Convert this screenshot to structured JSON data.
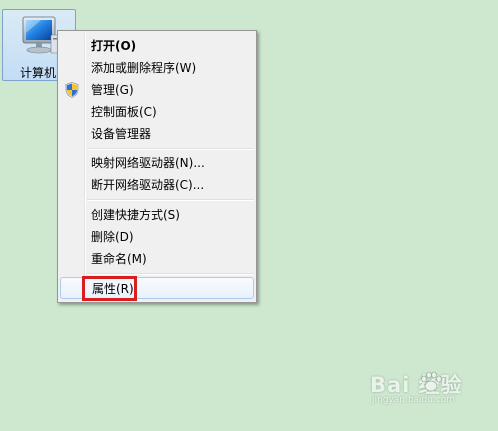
{
  "desktop": {
    "background_color": "#cde8cf",
    "icon": {
      "label": "计算机",
      "icon_name": "computer-icon"
    }
  },
  "context_menu": {
    "items": [
      {
        "label": "打开(O)",
        "bold": true
      },
      {
        "label": "添加或删除程序(W)"
      },
      {
        "label": "管理(G)",
        "icon_name": "uac-shield-icon"
      },
      {
        "label": "控制面板(C)"
      },
      {
        "label": "设备管理器"
      },
      {
        "label": "映射网络驱动器(N)..."
      },
      {
        "label": "断开网络驱动器(C)..."
      },
      {
        "label": "创建快捷方式(S)"
      },
      {
        "label": "删除(D)"
      },
      {
        "label": "重命名(M)"
      },
      {
        "label": "属性(R)",
        "highlighted": true
      }
    ],
    "highlight_box_color": "#d81e1e"
  },
  "watermark": {
    "brand": "Bai 经验",
    "url": "jingyan.baidu.com"
  }
}
